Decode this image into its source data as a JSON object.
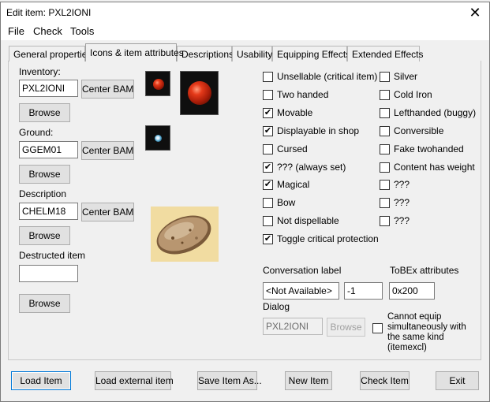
{
  "window": {
    "title": "Edit item: PXL2IONI"
  },
  "menu": {
    "file": "File",
    "check": "Check",
    "tools": "Tools"
  },
  "tabs": [
    "General properties",
    "Icons & item attributes",
    "Descriptions",
    "Usability",
    "Equipping Effects",
    "Extended Effects"
  ],
  "inventory": {
    "label": "Inventory:",
    "value": "PXL2IONI",
    "center_btn": "Center BAM",
    "browse_btn": "Browse"
  },
  "ground": {
    "label": "Ground:",
    "value": "GGEM01",
    "center_btn": "Center BAM",
    "browse_btn": "Browse"
  },
  "description": {
    "label": "Description",
    "value": "CHELM18",
    "center_btn": "Center BAM",
    "browse_btn": "Browse"
  },
  "destructed": {
    "label": "Destructed item",
    "value": "",
    "browse_btn": "Browse"
  },
  "flags_left": [
    {
      "label": "Unsellable (critical item)",
      "checked": false
    },
    {
      "label": "Two handed",
      "checked": false
    },
    {
      "label": "Movable",
      "checked": true
    },
    {
      "label": "Displayable in shop",
      "checked": true
    },
    {
      "label": "Cursed",
      "checked": false
    },
    {
      "label": "??? (always set)",
      "checked": true
    },
    {
      "label": "Magical",
      "checked": true
    },
    {
      "label": "Bow",
      "checked": false
    },
    {
      "label": "Not dispellable",
      "checked": false
    },
    {
      "label": "Toggle critical protection",
      "checked": true
    }
  ],
  "flags_right": [
    {
      "label": "Silver",
      "checked": false
    },
    {
      "label": "Cold Iron",
      "checked": false
    },
    {
      "label": "Lefthanded (buggy)",
      "checked": false
    },
    {
      "label": "Conversible",
      "checked": false
    },
    {
      "label": "Fake twohanded",
      "checked": false
    },
    {
      "label": "Content has weight",
      "checked": false
    },
    {
      "label": "???",
      "checked": false
    },
    {
      "label": "???",
      "checked": false
    },
    {
      "label": "???",
      "checked": false
    }
  ],
  "conversation": {
    "label": "Conversation label",
    "value": "<Not Available>",
    "num": "-1"
  },
  "tobex": {
    "label": "ToBEx attributes",
    "value": "0x200"
  },
  "dialog": {
    "label": "Dialog",
    "value": "PXL2IONI",
    "browse_btn": "Browse"
  },
  "itemexcl": {
    "label": "Cannot equip simultaneously with the same kind (itemexcl)",
    "checked": false
  },
  "buttons": {
    "load_item": "Load Item",
    "load_external": "Load external item",
    "save_as": "Save Item As...",
    "new_item": "New Item",
    "check_item": "Check Item",
    "exit": "Exit"
  },
  "colors": {
    "focus": "#0078d7",
    "window_bg": "#f0f0f0"
  },
  "icons": {
    "close": "close-icon",
    "inventory": "red-gem-icon",
    "ground": "ground-gem-icon",
    "description": "stone-image"
  }
}
